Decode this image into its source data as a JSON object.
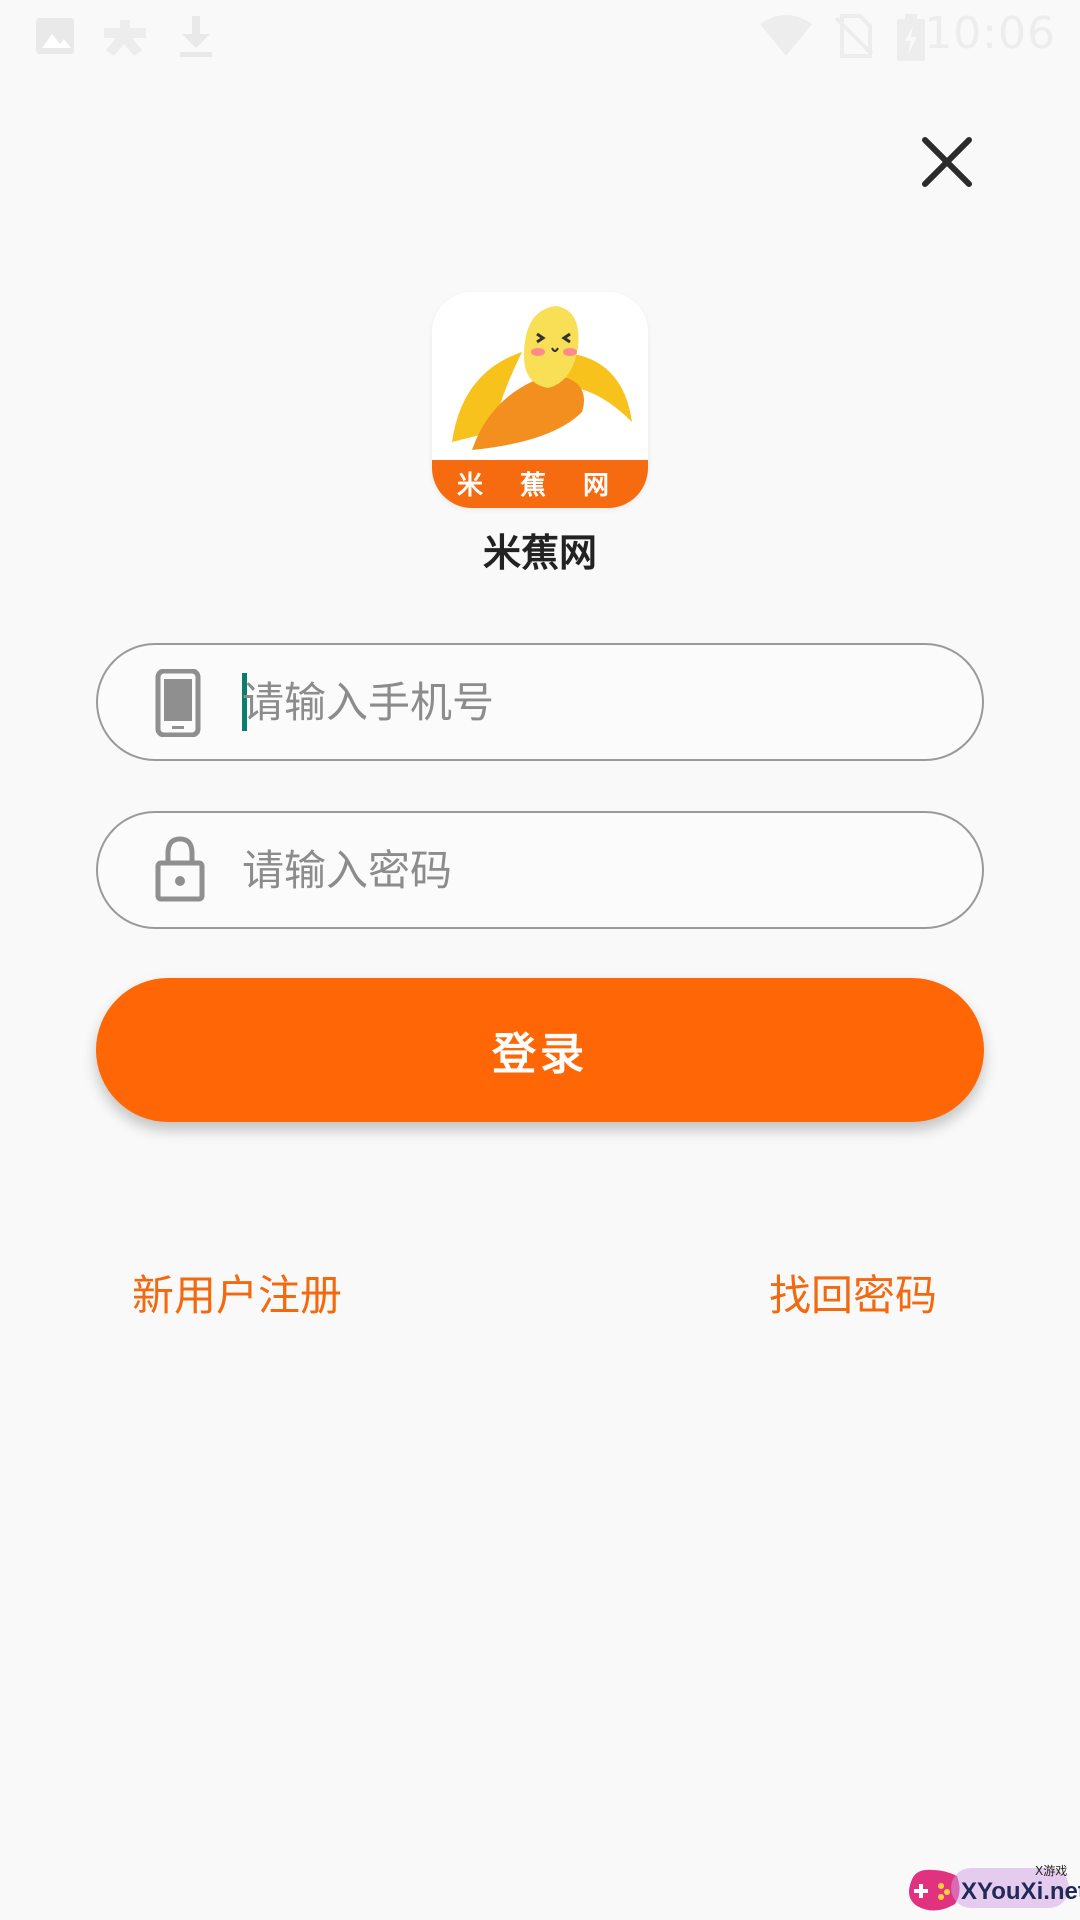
{
  "status_bar": {
    "time": "10:06",
    "icons": [
      "image-icon",
      "gamepad-icon",
      "download-icon",
      "wifi-icon",
      "no-sim-icon",
      "battery-icon"
    ]
  },
  "close": {
    "icon": "close-icon"
  },
  "logo": {
    "banner_text": "米 蕉 网",
    "icon": "banana-logo-icon"
  },
  "app_name": "米蕉网",
  "phone_field": {
    "placeholder": "请输入手机号",
    "icon": "phone-icon"
  },
  "password_field": {
    "placeholder": "请输入密码",
    "icon": "lock-icon"
  },
  "login_button": {
    "label": "登录"
  },
  "links": {
    "register": "新用户注册",
    "forgot": "找回密码"
  },
  "watermark": {
    "text": "XYouXi.net",
    "small": "X游戏"
  },
  "colors": {
    "accent": "#ff6605",
    "link": "#f2690f",
    "background": "#f9f9f9",
    "caret": "#0a7d6e"
  }
}
